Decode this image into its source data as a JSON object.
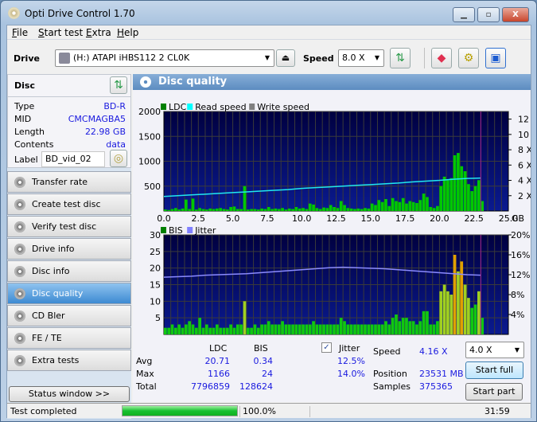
{
  "window": {
    "title": "Opti Drive Control 1.70",
    "minimize": "▁",
    "maximize": "▫",
    "close": "X"
  },
  "menu": [
    {
      "label": "File",
      "u": "F",
      "rest": "ile"
    },
    {
      "label": "Start test",
      "u": "S",
      "rest": "tart test"
    },
    {
      "label": "Extra",
      "u": "E",
      "rest": "xtra"
    },
    {
      "label": "Help",
      "u": "H",
      "rest": "elp"
    }
  ],
  "toolbar": {
    "drive_label": "Drive",
    "drive_value": "(H:)  ATAPI iHBS112  2 CL0K",
    "speed_label": "Speed",
    "speed_value": "8.0 X"
  },
  "disc": {
    "title": "Disc",
    "rows": [
      {
        "k": "Type",
        "v": "BD-R"
      },
      {
        "k": "MID",
        "v": "CMCMAGBA5"
      },
      {
        "k": "Length",
        "v": "22.98 GB"
      },
      {
        "k": "Contents",
        "v": "data"
      }
    ],
    "label_key": "Label",
    "label_value": "BD_vid_02"
  },
  "nav": [
    {
      "label": "Transfer rate"
    },
    {
      "label": "Create test disc"
    },
    {
      "label": "Verify test disc"
    },
    {
      "label": "Drive info"
    },
    {
      "label": "Disc info"
    },
    {
      "label": "Disc quality",
      "selected": true
    },
    {
      "label": "CD Bler"
    },
    {
      "label": "FE / TE"
    },
    {
      "label": "Extra tests"
    }
  ],
  "status_window_button": "Status window >>",
  "panel_title": "Disc quality",
  "chart_data": [
    {
      "type": "bar",
      "legend": [
        "LDC",
        "Read speed",
        "Write speed"
      ],
      "legend_colors": [
        "#008000",
        "#00ffff",
        "#808080"
      ],
      "x_step": 0.25,
      "xlim": [
        0,
        25
      ],
      "xticks": [
        "0.0",
        "2.5",
        "5.0",
        "7.5",
        "10.0",
        "12.5",
        "15.0",
        "17.5",
        "20.0",
        "22.5",
        "25.0"
      ],
      "xunit": "GB",
      "ylim": [
        0,
        2000
      ],
      "yticks": [
        "500",
        "1000",
        "1500",
        "2000"
      ],
      "y2lim": [
        0,
        13
      ],
      "y2ticks": [
        "2 X",
        "4 X",
        "6 X",
        "8 X",
        "10 X",
        "12 X"
      ],
      "ldc": [
        30,
        20,
        40,
        60,
        30,
        50,
        230,
        40,
        250,
        30,
        60,
        40,
        30,
        50,
        40,
        50,
        60,
        40,
        30,
        80,
        90,
        40,
        40,
        500,
        30,
        40,
        40,
        30,
        50,
        40,
        80,
        40,
        50,
        40,
        60,
        30,
        50,
        40,
        80,
        50,
        60,
        40,
        150,
        130,
        60,
        40,
        70,
        60,
        120,
        80,
        60,
        200,
        120,
        60,
        50,
        40,
        50,
        40,
        60,
        50,
        150,
        120,
        220,
        180,
        240,
        100,
        260,
        200,
        180,
        260,
        150,
        200,
        180,
        160,
        220,
        350,
        280,
        80,
        60,
        100,
        500,
        690,
        620,
        660,
        1120,
        1166,
        900,
        800,
        540,
        400,
        500,
        620,
        200
      ],
      "read_speed": [
        1.9,
        2.0,
        2.1,
        2.2,
        2.3,
        2.4,
        2.5,
        2.6,
        2.7,
        2.8,
        2.95,
        3.05,
        3.15,
        3.25,
        3.35,
        3.45,
        3.55,
        3.65,
        3.8,
        3.9,
        4.0,
        4.15,
        4.25,
        4.3
      ],
      "read_speed_x_step": 1,
      "end_marker": 23.0
    },
    {
      "type": "bar",
      "legend": [
        "BIS",
        "Jitter"
      ],
      "legend_colors": [
        "#008000",
        "#8080ff"
      ],
      "x_step": 0.25,
      "xlim": [
        0,
        25
      ],
      "xticks": [
        "0.0",
        "2.5",
        "5.0",
        "7.5",
        "10.0",
        "12.5",
        "15.0",
        "17.5",
        "20.0",
        "22.5",
        "25.0"
      ],
      "xunit": "GB",
      "ylim": [
        0,
        30
      ],
      "yticks": [
        "5",
        "10",
        "15",
        "20",
        "25",
        "30"
      ],
      "y2lim": [
        0,
        20
      ],
      "y2ticks": [
        "4%",
        "8%",
        "12%",
        "16%",
        "20%"
      ],
      "bis": [
        2,
        2,
        3,
        2,
        3,
        2,
        3,
        4,
        3,
        2,
        5,
        2,
        3,
        2,
        2,
        3,
        2,
        2,
        2,
        3,
        2,
        3,
        3,
        10,
        2,
        2,
        3,
        2,
        3,
        3,
        4,
        3,
        3,
        3,
        4,
        3,
        3,
        3,
        3,
        3,
        3,
        3,
        3,
        4,
        3,
        3,
        3,
        3,
        3,
        3,
        3,
        5,
        4,
        3,
        3,
        3,
        3,
        3,
        3,
        3,
        3,
        3,
        3,
        3,
        4,
        3,
        5,
        6,
        4,
        5,
        5,
        4,
        4,
        3,
        4,
        7,
        7,
        3,
        3,
        4,
        13,
        15,
        13,
        12,
        24,
        19,
        22,
        15,
        11,
        8,
        9,
        13,
        5
      ],
      "jitter": [
        11.5,
        11.6,
        11.7,
        11.9,
        12.0,
        12.1,
        12.2,
        12.4,
        12.6,
        12.8,
        13.0,
        13.2,
        13.4,
        13.5,
        13.4,
        13.3,
        13.2,
        13.0,
        12.8,
        12.6,
        12.4,
        12.2,
        12.0,
        11.9
      ],
      "jitter_x_step": 1,
      "end_marker": 23.0
    }
  ],
  "stats": {
    "col_ldc": "LDC",
    "col_bis": "BIS",
    "jitter_label": "Jitter",
    "jitter_checked": true,
    "rows": [
      {
        "k": "Avg",
        "ldc": "20.71",
        "bis": "0.34",
        "jit": "12.5%"
      },
      {
        "k": "Max",
        "ldc": "1166",
        "bis": "24",
        "jit": "14.0%"
      },
      {
        "k": "Total",
        "ldc": "7796859",
        "bis": "128624",
        "jit": ""
      }
    ],
    "speed_label": "Speed",
    "speed_value": "4.16 X",
    "position_label": "Position",
    "position_value": "23531 MB",
    "samples_label": "Samples",
    "samples_value": "375365",
    "speed_select": "4.0 X",
    "start_full": "Start full",
    "start_part": "Start part"
  },
  "status": {
    "text": "Test completed",
    "progress": 100.0,
    "progress_text": "100.0%",
    "time": "31:59"
  }
}
